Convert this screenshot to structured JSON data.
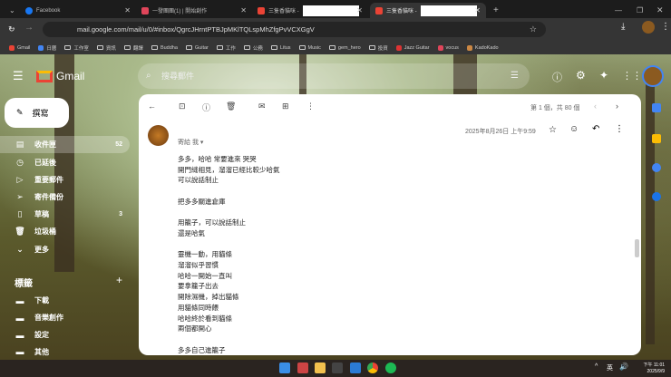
{
  "browser": {
    "tabs": [
      {
        "title": "Facebook",
        "color": "#1877f2"
      },
      {
        "title": "一發團團(1) | 開始創作",
        "color": "#e0455a"
      },
      {
        "title": "三隻香貓咪 -",
        "color": "#ea4335"
      },
      {
        "title": "三隻香貓咪 -",
        "color": "#ea4335"
      }
    ],
    "url": "mail.google.com/mail/u/0/#inbox/QgrcJHrntPTBJpMKlTQLspMhZfgPvVCXGgV",
    "bookmarks": [
      "Gmail",
      "日曆",
      "工作室",
      "資訊",
      "翻譯",
      "Buddha",
      "Guitar",
      "工作",
      "公務",
      "Litus",
      "Music",
      "gem_hero",
      "投資",
      "Jazz Guitar",
      "vocus",
      "KadoKado"
    ]
  },
  "gmail": {
    "logo": "Gmail",
    "search_placeholder": "搜尋郵件",
    "compose": "撰寫",
    "nav": [
      {
        "label": "收件匣",
        "count": "52",
        "icon": "inbox-icon"
      },
      {
        "label": "已延後",
        "count": "",
        "icon": "clock-icon"
      },
      {
        "label": "重要郵件",
        "count": "",
        "icon": "important-icon"
      },
      {
        "label": "寄件備份",
        "count": "",
        "icon": "send-icon"
      },
      {
        "label": "草稿",
        "count": "3",
        "icon": "draft-icon"
      },
      {
        "label": "垃圾桶",
        "count": "",
        "icon": "trash-icon"
      },
      {
        "label": "更多",
        "count": "",
        "icon": "chevron-down-icon"
      }
    ],
    "labels_title": "標籤",
    "labels": [
      "下載",
      "音樂創作",
      "設定",
      "其他"
    ],
    "pagination": "第 1 個，共 80 個",
    "email": {
      "recipient": "寄給 我",
      "date": "2025年8月26日 上午9:59",
      "lines": [
        "多多，哈哈 常要進來 哭哭",
        "開門縫相見，溜溜已經比較少哈氣",
        "可以說話制止",
        "",
        "把多多關進倉庫",
        "",
        "用籠子，可以說話制止",
        "還是哈氣",
        "",
        "靈機一動，用貓條",
        "溜溜似乎習慣",
        "哈哈一開始一直叫",
        "要拿籠子出去",
        "開除濕機，掉出貓條",
        "用貓條同時餵",
        "哈哈終於看到貓條",
        "兩個都開心",
        "",
        "多多自己進籠子"
      ]
    }
  },
  "taskbar": {
    "lang": "英",
    "time": "下午 11:01",
    "date": "2025/9/9"
  }
}
